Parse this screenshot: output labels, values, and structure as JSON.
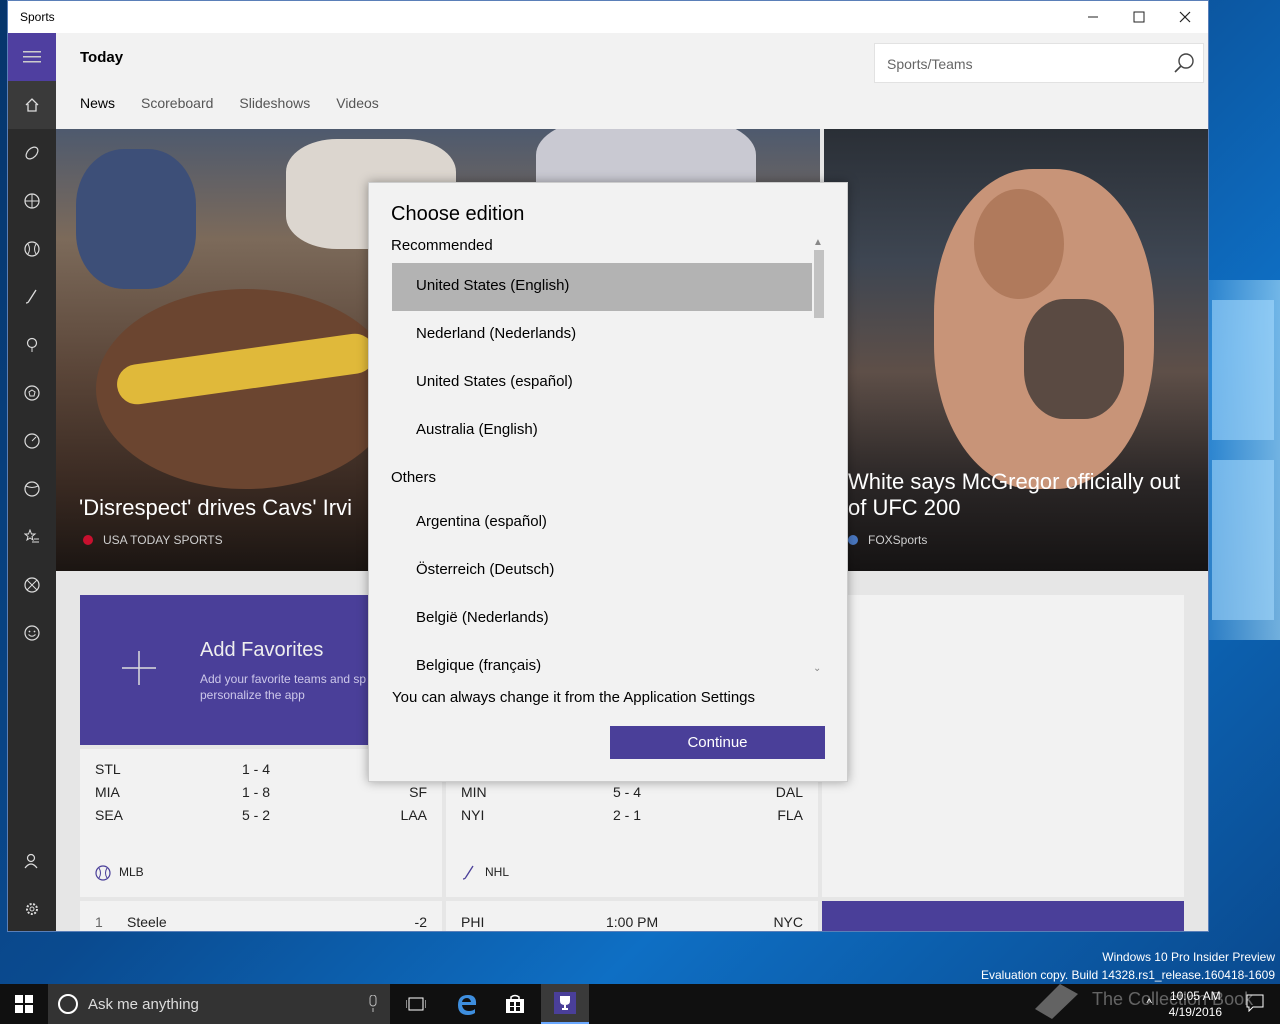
{
  "desktop": {
    "watermark_line1": "Windows 10 Pro Insider Preview",
    "watermark_line2": "Evaluation copy. Build 14328.rs1_release.160418-1609"
  },
  "window": {
    "title": "Sports",
    "minimize_icon": "minimize-icon",
    "maximize_icon": "maximize-icon",
    "close_icon": "close-icon"
  },
  "rail": {
    "items": [
      "home-icon",
      "football-icon",
      "basketball-icon",
      "baseball-icon",
      "hockey-icon",
      "golf-icon",
      "soccer-icon",
      "racing-icon",
      "tennis-icon",
      "favorites-icon",
      "more-sports-icon",
      "fantasy-icon",
      "account-icon",
      "settings-icon"
    ]
  },
  "header": {
    "title": "Today",
    "search_placeholder": "Sports/Teams",
    "tabs": [
      "News",
      "Scoreboard",
      "Slideshows",
      "Videos"
    ]
  },
  "hero": {
    "left_headline": "'Disrespect' drives Cavs' Irvi",
    "left_source": "USA TODAY SPORTS",
    "right_headline": "White says McGregor officially out of UFC 200",
    "right_source": "FOXSports"
  },
  "favorites": {
    "title": "Add Favorites",
    "subtitle": "Add your favorite teams and sp personalize the app"
  },
  "scores": {
    "mlb": {
      "league": "MLB",
      "rows": [
        {
          "home": "STL",
          "score": "1  -  4",
          "away": ""
        },
        {
          "home": "MIA",
          "score": "1  -  8",
          "away": "SF"
        },
        {
          "home": "SEA",
          "score": "5  -  2",
          "away": "LAA"
        }
      ],
      "golf_rank": "1",
      "golf_name": "Steele",
      "golf_score": "-2"
    },
    "nhl": {
      "league": "NHL",
      "rows": [
        {
          "home": "MIN",
          "score": "5  -  4",
          "away": "DAL"
        },
        {
          "home": "NYI",
          "score": "2  -  1",
          "away": "FLA"
        }
      ],
      "next_home": "PHI",
      "next_time": "1:00 PM",
      "next_away": "NYC"
    }
  },
  "dialog": {
    "title": "Choose edition",
    "recommended_label": "Recommended",
    "recommended": [
      "United States (English)",
      "Nederland (Nederlands)",
      "United States (español)",
      "Australia (English)"
    ],
    "others_label": "Others",
    "others": [
      "Argentina (español)",
      "Österreich (Deutsch)",
      "België (Nederlands)",
      "Belgique (français)"
    ],
    "selected": "United States (English)",
    "note": "You can always change it from the Application Settings",
    "continue_label": "Continue"
  },
  "taskbar": {
    "search_placeholder": "Ask me anything",
    "time": "10:05 AM",
    "date": "4/19/2016",
    "brand": "The Collection Book"
  },
  "colors": {
    "accent": "#4a3f99",
    "rail": "#2b2b2b",
    "selected_item": "#b3b3b3"
  }
}
